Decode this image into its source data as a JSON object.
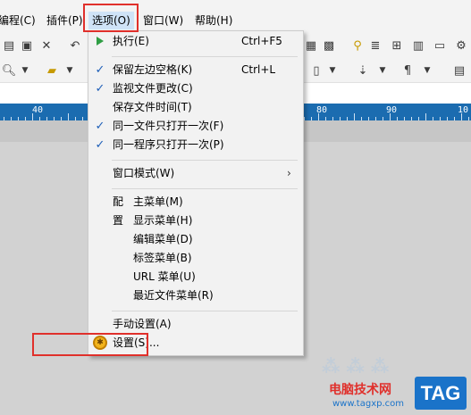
{
  "menubar": {
    "items": [
      {
        "label": "编程(C)"
      },
      {
        "label": "插件(P)"
      },
      {
        "label": "选项(O)"
      },
      {
        "label": "窗口(W)"
      },
      {
        "label": "帮助(H)"
      }
    ]
  },
  "ruler": {
    "labels": [
      "40",
      "80",
      "90",
      "10"
    ]
  },
  "options_menu": {
    "items": [
      {
        "label": "执行(E)",
        "shortcut": "Ctrl+F5",
        "icon": "play-icon"
      },
      {
        "label": "保留左边空格(K)",
        "shortcut": "Ctrl+L",
        "checked": true
      },
      {
        "label": "监视文件更改(C)",
        "checked": true
      },
      {
        "label": "保存文件时间(T)",
        "checked": false
      },
      {
        "label": "同一文件只打开一次(F)",
        "checked": true
      },
      {
        "label": "同一程序只打开一次(P)",
        "checked": true
      },
      {
        "label": "窗口模式(W)",
        "submenu": true
      },
      {
        "prefix": "配",
        "label": "主菜单(M)"
      },
      {
        "prefix": "置",
        "label": "显示菜单(H)"
      },
      {
        "label": "编辑菜单(D)"
      },
      {
        "label": "标签菜单(B)"
      },
      {
        "label": "URL 菜单(U)"
      },
      {
        "label": "最近文件菜单(R)"
      },
      {
        "label": "手动设置(A)"
      },
      {
        "label": "设置(S)...",
        "icon": "gear-icon"
      }
    ]
  },
  "watermark": {
    "site_name": "电脑技术网",
    "url": "www.tagxp.com",
    "tag": "TAG"
  },
  "colors": {
    "highlight_box": "#e0302b",
    "ruler": "#1b6cb0",
    "check": "#1f5fb8"
  }
}
